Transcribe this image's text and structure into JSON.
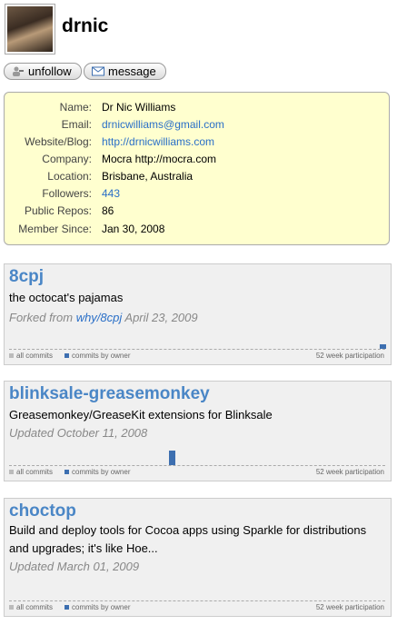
{
  "profile": {
    "username": "drnic"
  },
  "actions": {
    "unfollow_label": "unfollow",
    "message_label": "message"
  },
  "info": [
    {
      "label": "Name:",
      "value": "Dr Nic Williams",
      "link": false
    },
    {
      "label": "Email:",
      "value": "drnicwilliams@gmail.com",
      "link": true
    },
    {
      "label": "Website/Blog:",
      "value": "http://drnicwilliams.com",
      "link": true
    },
    {
      "label": "Company:",
      "value": "Mocra http://mocra.com",
      "link": false
    },
    {
      "label": "Location:",
      "value": "Brisbane, Australia",
      "link": false
    },
    {
      "label": "Followers:",
      "value": "443",
      "link": true
    },
    {
      "label": "Public Repos:",
      "value": "86",
      "link": false
    },
    {
      "label": "Member Since:",
      "value": "Jan 30, 2008",
      "link": false
    }
  ],
  "legend": {
    "all": "all commits",
    "owner": "commits by owner",
    "participation": "52 week participation"
  },
  "repos": [
    {
      "name": "8cpj",
      "description": "the octocat's pajamas",
      "meta_prefix": "Forked from ",
      "meta_link": "why/8cpj",
      "meta_suffix": " April 23, 2009",
      "bar_week": 51,
      "bar_level": 0.3
    },
    {
      "name": "blinksale-greasemonkey",
      "description": "Greasemonkey/GreaseKit extensions for Blinksale",
      "meta_prefix": "Updated October 11, 2008",
      "meta_link": "",
      "meta_suffix": "",
      "bar_week": 22,
      "bar_level": 1.0
    },
    {
      "name": "choctop",
      "description": "Build and deploy tools for Cocoa apps using Sparkle for distributions and upgrades; it's like Hoe...",
      "meta_prefix": "Updated March 01, 2009",
      "meta_link": "",
      "meta_suffix": "",
      "bar_week": null,
      "bar_level": 0
    }
  ],
  "colors": {
    "link": "#2a6fc7",
    "repo_name": "#4a86c6",
    "info_bg": "#ffffcf",
    "all_commits": "#bbbbbb",
    "owner_commits": "#3d6fb0"
  }
}
